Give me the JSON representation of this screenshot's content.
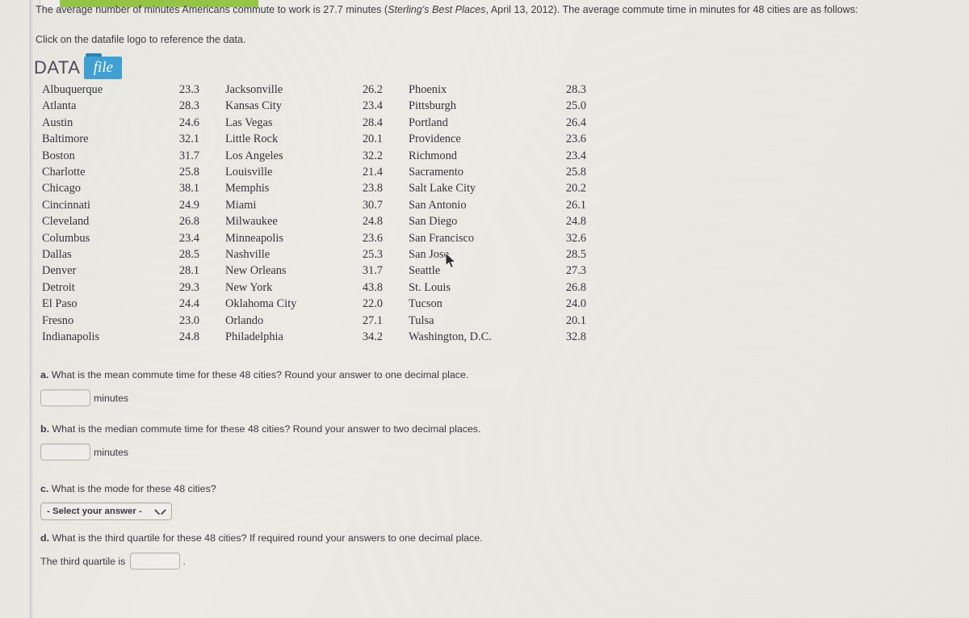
{
  "intro": {
    "line1_pre": "The average number of minutes Americans commute to work is 27.7 minutes (",
    "line1_source": "Sterling's Best Places",
    "line1_post": ", April 13, 2012). The average commute time in minutes for 48 cities are as follows:",
    "line2": "Click on the datafile logo to reference the data."
  },
  "datafile_logo": {
    "word": "DATA",
    "folder_label": "file"
  },
  "table": {
    "rows": [
      {
        "city_a": "Albuquerque",
        "val_a": "23.3",
        "city_b": "Jacksonville",
        "val_b": "26.2",
        "city_c": "Phoenix",
        "val_c": "28.3"
      },
      {
        "city_a": "Atlanta",
        "val_a": "28.3",
        "city_b": "Kansas City",
        "val_b": "23.4",
        "city_c": "Pittsburgh",
        "val_c": "25.0"
      },
      {
        "city_a": "Austin",
        "val_a": "24.6",
        "city_b": "Las Vegas",
        "val_b": "28.4",
        "city_c": "Portland",
        "val_c": "26.4"
      },
      {
        "city_a": "Baltimore",
        "val_a": "32.1",
        "city_b": "Little Rock",
        "val_b": "20.1",
        "city_c": "Providence",
        "val_c": "23.6"
      },
      {
        "city_a": "Boston",
        "val_a": "31.7",
        "city_b": "Los Angeles",
        "val_b": "32.2",
        "city_c": "Richmond",
        "val_c": "23.4"
      },
      {
        "city_a": "Charlotte",
        "val_a": "25.8",
        "city_b": "Louisville",
        "val_b": "21.4",
        "city_c": "Sacramento",
        "val_c": "25.8"
      },
      {
        "city_a": "Chicago",
        "val_a": "38.1",
        "city_b": "Memphis",
        "val_b": "23.8",
        "city_c": "Salt Lake City",
        "val_c": "20.2"
      },
      {
        "city_a": "Cincinnati",
        "val_a": "24.9",
        "city_b": "Miami",
        "val_b": "30.7",
        "city_c": "San Antonio",
        "val_c": "26.1"
      },
      {
        "city_a": "Cleveland",
        "val_a": "26.8",
        "city_b": "Milwaukee",
        "val_b": "24.8",
        "city_c": "San Diego",
        "val_c": "24.8"
      },
      {
        "city_a": "Columbus",
        "val_a": "23.4",
        "city_b": "Minneapolis",
        "val_b": "23.6",
        "city_c": "San Francisco",
        "val_c": "32.6"
      },
      {
        "city_a": "Dallas",
        "val_a": "28.5",
        "city_b": "Nashville",
        "val_b": "25.3",
        "city_c": "San Jose",
        "val_c": "28.5"
      },
      {
        "city_a": "Denver",
        "val_a": "28.1",
        "city_b": "New Orleans",
        "val_b": "31.7",
        "city_c": "Seattle",
        "val_c": "27.3"
      },
      {
        "city_a": "Detroit",
        "val_a": "29.3",
        "city_b": "New York",
        "val_b": "43.8",
        "city_c": "St. Louis",
        "val_c": "26.8"
      },
      {
        "city_a": "El Paso",
        "val_a": "24.4",
        "city_b": "Oklahoma City",
        "val_b": "22.0",
        "city_c": "Tucson",
        "val_c": "24.0"
      },
      {
        "city_a": "Fresno",
        "val_a": "23.0",
        "city_b": "Orlando",
        "val_b": "27.1",
        "city_c": "Tulsa",
        "val_c": "20.1"
      },
      {
        "city_a": "Indianapolis",
        "val_a": "24.8",
        "city_b": "Philadelphia",
        "val_b": "34.2",
        "city_c": "Washington, D.C.",
        "val_c": "32.8"
      }
    ]
  },
  "questions": {
    "a": {
      "marker": "a.",
      "text": "What is the mean commute time for these 48 cities? Round your answer to one decimal place.",
      "value": "",
      "unit": "minutes"
    },
    "b": {
      "marker": "b.",
      "text": "What is the median commute time for these 48 cities? Round your answer to two decimal places.",
      "value": "",
      "unit": "minutes"
    },
    "c": {
      "marker": "c.",
      "text": "What is the mode for these 48 cities?",
      "select_value": "- Select your answer -"
    },
    "d": {
      "marker": "d.",
      "text": "What is the third quartile for these 48 cities? If required round your answers to one decimal place.",
      "prefix": "The third quartile is",
      "value": "",
      "suffix": "."
    }
  },
  "colors": {
    "page_background": "#eceae4",
    "progress_green": "#97c646",
    "folder_blue": "#40a2d4",
    "text": "#3b3b44"
  }
}
